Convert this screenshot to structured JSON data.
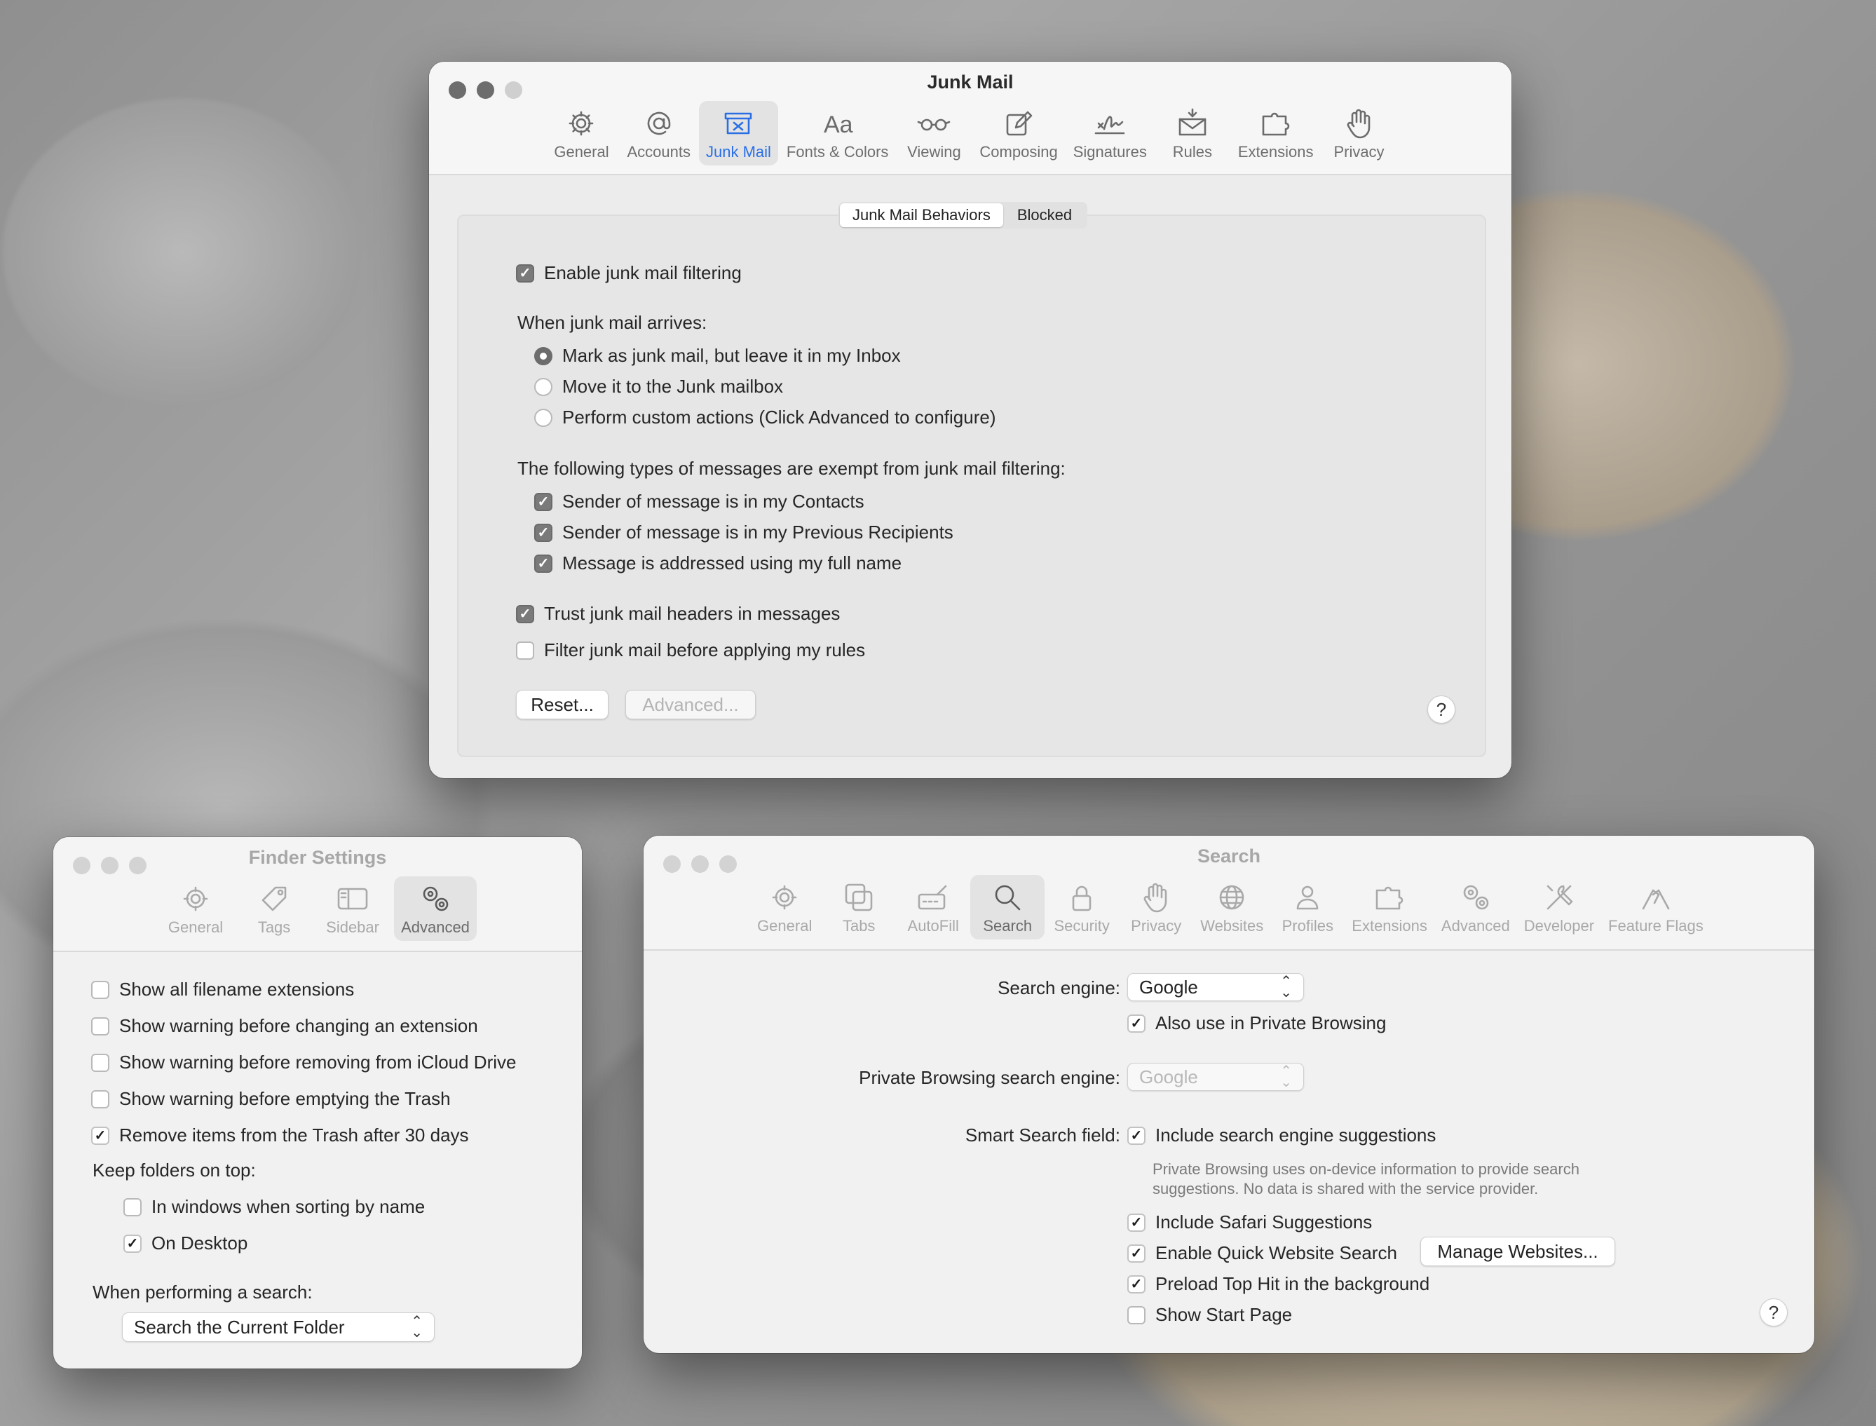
{
  "mail": {
    "title": "Junk Mail",
    "tabs": [
      {
        "label": "General"
      },
      {
        "label": "Accounts"
      },
      {
        "label": "Junk Mail"
      },
      {
        "label": "Fonts & Colors"
      },
      {
        "label": "Viewing"
      },
      {
        "label": "Composing"
      },
      {
        "label": "Signatures"
      },
      {
        "label": "Rules"
      },
      {
        "label": "Extensions"
      },
      {
        "label": "Privacy"
      }
    ],
    "segments": [
      "Junk Mail Behaviors",
      "Blocked"
    ],
    "enable_filtering": "Enable junk mail filtering",
    "arrives_heading": "When junk mail arrives:",
    "arrives_options": [
      "Mark as junk mail, but leave it in my Inbox",
      "Move it to the Junk mailbox",
      "Perform custom actions (Click Advanced to configure)"
    ],
    "exempt_heading": "The following types of messages are exempt from junk mail filtering:",
    "exempt_options": [
      "Sender of message is in my Contacts",
      "Sender of message is in my Previous Recipients",
      "Message is addressed using my full name"
    ],
    "trust_headers": "Trust junk mail headers in messages",
    "filter_before_rules": "Filter junk mail before applying my rules",
    "reset_button": "Reset...",
    "advanced_button": "Advanced...",
    "help": "?"
  },
  "finder": {
    "title": "Finder Settings",
    "tabs": [
      {
        "label": "General"
      },
      {
        "label": "Tags"
      },
      {
        "label": "Sidebar"
      },
      {
        "label": "Advanced"
      }
    ],
    "options": [
      "Show all filename extensions",
      "Show warning before changing an extension",
      "Show warning before removing from iCloud Drive",
      "Show warning before emptying the Trash",
      "Remove items from the Trash after 30 days"
    ],
    "folders_heading": "Keep folders on top:",
    "folder_options": [
      "In windows when sorting by name",
      "On Desktop"
    ],
    "search_heading": "When performing a search:",
    "search_scope": "Search the Current Folder"
  },
  "safari": {
    "title": "Search",
    "tabs": [
      {
        "label": "General"
      },
      {
        "label": "Tabs"
      },
      {
        "label": "AutoFill"
      },
      {
        "label": "Search"
      },
      {
        "label": "Security"
      },
      {
        "label": "Privacy"
      },
      {
        "label": "Websites"
      },
      {
        "label": "Profiles"
      },
      {
        "label": "Extensions"
      },
      {
        "label": "Advanced"
      },
      {
        "label": "Developer"
      },
      {
        "label": "Feature Flags"
      }
    ],
    "search_engine_label": "Search engine:",
    "search_engine_value": "Google",
    "also_private": "Also use in Private Browsing",
    "private_engine_label": "Private Browsing search engine:",
    "private_engine_value": "Google",
    "smart_field_label": "Smart Search field:",
    "include_suggestions": "Include search engine suggestions",
    "note_line1": "Private Browsing uses on-device information to provide search",
    "note_line2": "suggestions. No data is shared with the service provider.",
    "include_safari_suggestions": "Include Safari Suggestions",
    "quick_website_search": "Enable Quick Website Search",
    "manage_websites": "Manage Websites...",
    "preload_top_hit": "Preload Top Hit in the background",
    "show_start_page": "Show Start Page",
    "help": "?"
  }
}
